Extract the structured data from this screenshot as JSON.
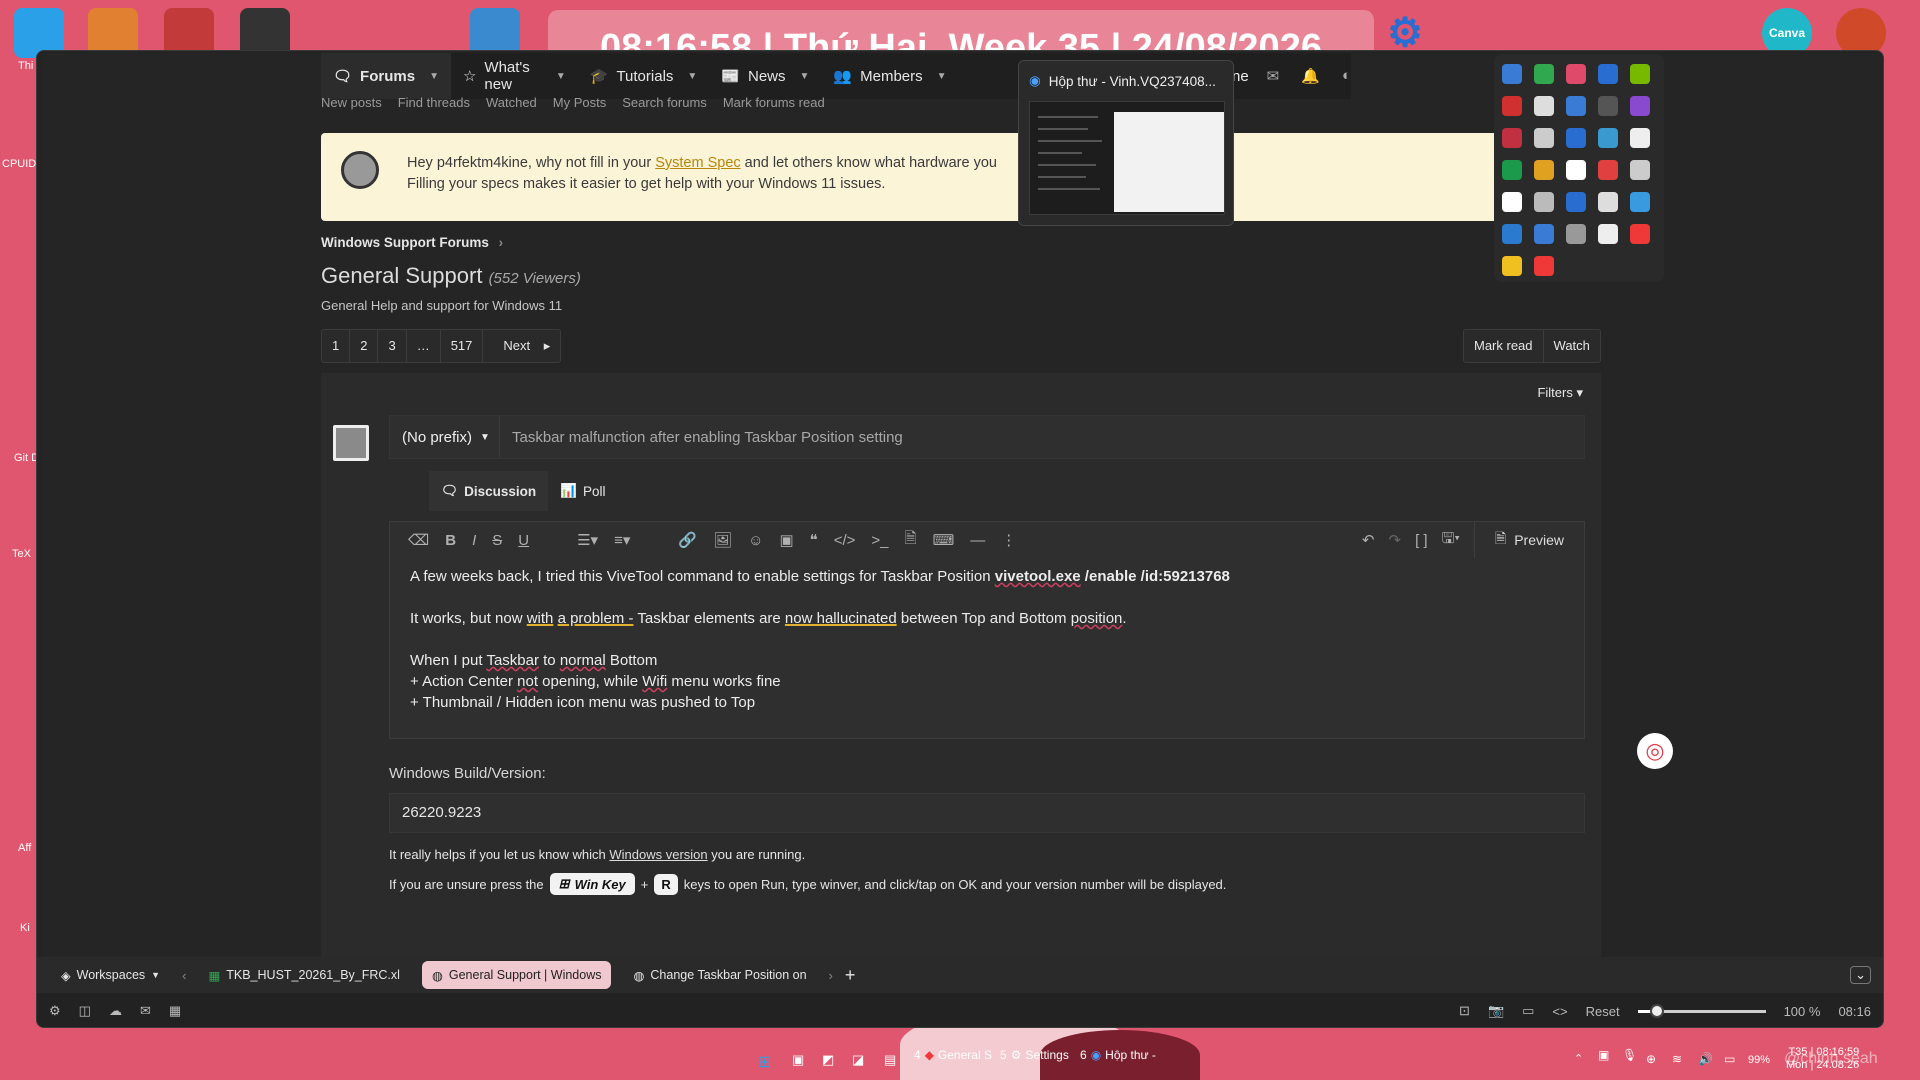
{
  "desktop": {
    "clock_text": "08:16:58 | Thứ Hai, Week 35 | 24/08/2026",
    "labels": [
      "Thi",
      "CPUID",
      "Git Des",
      "TeX",
      "Aff",
      "Ki"
    ],
    "canva_label": "Canva",
    "watermark": "@chinh.seah"
  },
  "nav": {
    "items": [
      {
        "label": "Forums",
        "icon": "forums-icon"
      },
      {
        "label": "What's new",
        "icon": "star-icon"
      },
      {
        "label": "Tutorials",
        "icon": "graduation-cap-icon"
      },
      {
        "label": "News",
        "icon": "newspaper-icon"
      },
      {
        "label": "Members",
        "icon": "users-icon"
      }
    ],
    "username": "p4rfektm4kine",
    "subnav": [
      "New posts",
      "Find threads",
      "Watched",
      "My Posts",
      "Search forums",
      "Mark forums read"
    ]
  },
  "thumbnail_popup": {
    "title": "Hộp thư - Vinh.VQ237408..."
  },
  "notice": {
    "text_before": "Hey p4rfektm4kine, why not fill in your ",
    "link": "System Spec",
    "text_after": " and let others know what hardware you",
    "line2": "Filling your specs makes it easier to get help with your Windows 11 issues."
  },
  "breadcrumb": "Windows Support Forums",
  "forum": {
    "title": "General Support",
    "viewers": "(552 Viewers)",
    "description": "General Help and support for Windows 11"
  },
  "pagination": [
    "1",
    "2",
    "3",
    "…",
    "517",
    "Next"
  ],
  "actions": {
    "mark_read": "Mark read",
    "watch": "Watch",
    "filters": "Filters"
  },
  "compose": {
    "prefix": "(No prefix)",
    "title_value": "Taskbar malfunction after enabling Taskbar Position setting",
    "tabs": [
      "Discussion",
      "Poll"
    ],
    "preview_label": "Preview",
    "body": {
      "p1_text": "A few weeks back, I tried this ViveTool command to enable settings for Taskbar Position ",
      "p1_cmd1": "vivetool.exe",
      "p1_cmd2": " /enable /id:59213768",
      "p2_a": "It works, but now ",
      "p2_with": "with",
      "p2_sp": " ",
      "p2_problem": "a problem -",
      "p2_b": " Taskbar elements are ",
      "p2_hall": "now hallucinated",
      "p2_c": " between Top and Bottom ",
      "p2_pos": "position",
      "p2_d": ".",
      "l1_a": "When I put ",
      "l1_taskbar": "Taskbar",
      "l1_b": " to ",
      "l1_normal": "normal",
      "l1_c": " Bottom",
      "l2_a": "+ Action Center ",
      "l2_not": "not",
      "l2_b": " opening, while ",
      "l2_wifi": "Wifi",
      "l2_c": " menu works fine",
      "l3": "+ Thumbnail / Hidden icon menu was pushed to Top"
    },
    "build_label": "Windows Build/Version:",
    "build_value": "26220.9223",
    "help1_a": "It really helps if you let us know which ",
    "help1_link": "Windows version",
    "help1_b": " you are running.",
    "help2_a": "If you are unsure press the",
    "key_win": "Win Key",
    "plus": "+",
    "key_r": "R",
    "help2_b": "keys to open Run, type winver, and click/tap on OK and your version number will be displayed."
  },
  "browser": {
    "workspaces_label": "Workspaces",
    "tabs": [
      {
        "label": "TKB_HUST_20261_By_FRC.xl"
      },
      {
        "label": "General Support | Windows"
      },
      {
        "label": "Change Taskbar Position on"
      }
    ],
    "reset_label": "Reset",
    "zoom": "100 %",
    "zoom_level": 0.15,
    "time": "08:16"
  },
  "taskbar": {
    "items": [
      {
        "num": "4",
        "label": "General S"
      },
      {
        "num": "5",
        "label": "Settings"
      },
      {
        "num": "6",
        "label": "Hộp thư -"
      }
    ],
    "battery": "99%",
    "clock_line1": "T35 | 08:16:59",
    "clock_line2": "Mon | 24.08.26"
  },
  "colors": {
    "accent_pink": "#e0566e",
    "notice_bg": "#fbf4d7",
    "link_gold": "#b8860b"
  }
}
